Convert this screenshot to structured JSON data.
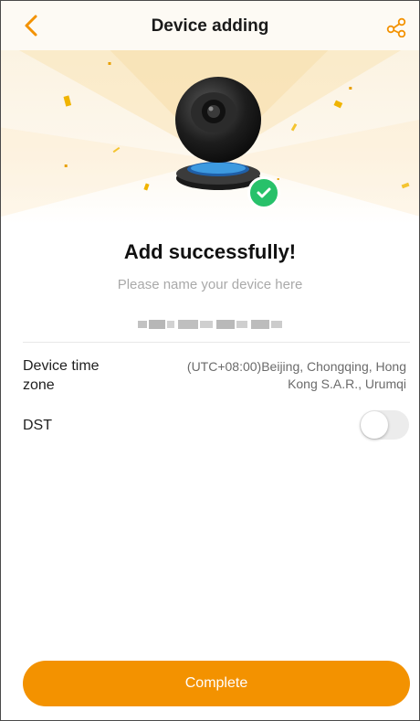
{
  "header": {
    "title": "Device adding",
    "back_icon": "chevron-left-icon",
    "share_icon": "share-icon"
  },
  "hero": {
    "image": "camera-illustration",
    "badge_icon": "checkmark-icon"
  },
  "result": {
    "title": "Add successfully!",
    "name_placeholder": "Please name your device here",
    "device_name_blurred": true
  },
  "settings": {
    "timezone": {
      "label_line1": "Device time",
      "label_line2": "zone",
      "value_line1": "(UTC+08:00)Beijing, Chongqing, Hong",
      "value_line2": "Kong S.A.R., Urumqi"
    },
    "dst": {
      "label": "DST",
      "enabled": false
    }
  },
  "footer": {
    "complete_label": "Complete"
  },
  "colors": {
    "accent": "#f39200",
    "success": "#27c16a",
    "header_bg": "#fdfaf4"
  }
}
